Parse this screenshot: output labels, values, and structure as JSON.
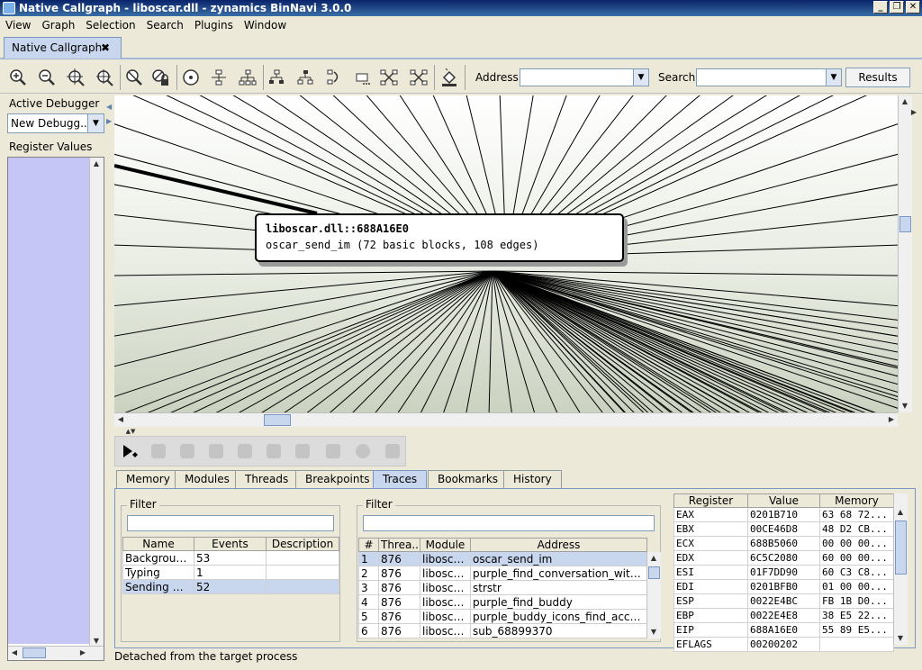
{
  "window": {
    "title": "Native Callgraph - liboscar.dll - zynamics BinNavi 3.0.0",
    "buttons": [
      "_",
      "❐",
      "✕"
    ]
  },
  "menu": [
    "View",
    "Graph",
    "Selection",
    "Search",
    "Plugins",
    "Window"
  ],
  "doc_tab": {
    "label": "Native Callgraph",
    "close": "✖"
  },
  "toolbar": {
    "icons": [
      "zoom-in-icon",
      "zoom-out-icon",
      "zoom-fit-icon",
      "zoom-selection-icon",
      "magnifier-icon",
      "proximity-lock-icon",
      "circular-layout-icon",
      "orthogonal-layout-icon",
      "hierarchic-layout-icon",
      "select-children-icon",
      "select-parents-icon",
      "select-successors-icon",
      "select-by-criteria-icon",
      "delete-selected-icon",
      "delete-unselected-icon",
      "color-fill-icon"
    ],
    "address_label": "Address",
    "address_value": "",
    "search_label": "Search",
    "search_value": "",
    "results_label": "Results"
  },
  "left": {
    "active_debugger_title": "Active Debugger",
    "debugger_value": "New Debugg...",
    "register_values_title": "Register Values"
  },
  "graph": {
    "node_title": "liboscar.dll::688A16E0",
    "node_subtitle": "oscar_send_im (72 basic blocks, 108 edges)"
  },
  "bottom_tabs": [
    "Memory",
    "Modules",
    "Threads",
    "Breakpoints",
    "Traces",
    "Bookmarks",
    "History"
  ],
  "bottom_selected_tab": "Traces",
  "events": {
    "filter_label": "Filter",
    "columns": [
      "Name",
      "Events",
      "Description"
    ],
    "rows": [
      [
        "Background...",
        "53",
        ""
      ],
      [
        "Typing",
        "1",
        ""
      ],
      [
        "Sending Me...",
        "52",
        ""
      ]
    ],
    "selected_row": 2
  },
  "trace": {
    "filter_label": "Filter",
    "columns": [
      "#",
      "Threa...",
      "Module",
      "Address"
    ],
    "rows": [
      [
        "1",
        "876",
        "liboscar...",
        "oscar_send_im"
      ],
      [
        "2",
        "876",
        "liboscar...",
        "purple_find_conversation_with_..."
      ],
      [
        "3",
        "876",
        "liboscar...",
        "strstr"
      ],
      [
        "4",
        "876",
        "liboscar...",
        "purple_find_buddy"
      ],
      [
        "5",
        "876",
        "liboscar...",
        "purple_buddy_icons_find_accou..."
      ],
      [
        "6",
        "876",
        "liboscar...",
        "sub_68899370"
      ]
    ],
    "selected_row": 0
  },
  "registers": {
    "columns": [
      "Register",
      "Value",
      "Memory"
    ],
    "rows": [
      [
        "EAX",
        "0201B710",
        "63 68 72..."
      ],
      [
        "EBX",
        "00CE46D8",
        "48 D2 CB..."
      ],
      [
        "ECX",
        "688B5060",
        "00 00 00..."
      ],
      [
        "EDX",
        "6C5C2080",
        "60 00 00..."
      ],
      [
        "ESI",
        "01F7DD90",
        "60 C3 C8..."
      ],
      [
        "EDI",
        "0201BFB0",
        "01 00 00..."
      ],
      [
        "ESP",
        "0022E4BC",
        "FB 1B D0..."
      ],
      [
        "EBP",
        "0022E4E8",
        "38 E5 22..."
      ],
      [
        "EIP",
        "688A16E0",
        "55 89 E5..."
      ],
      [
        "EFLAGS",
        "00200202",
        ""
      ]
    ]
  },
  "status": "Detached from the target process"
}
